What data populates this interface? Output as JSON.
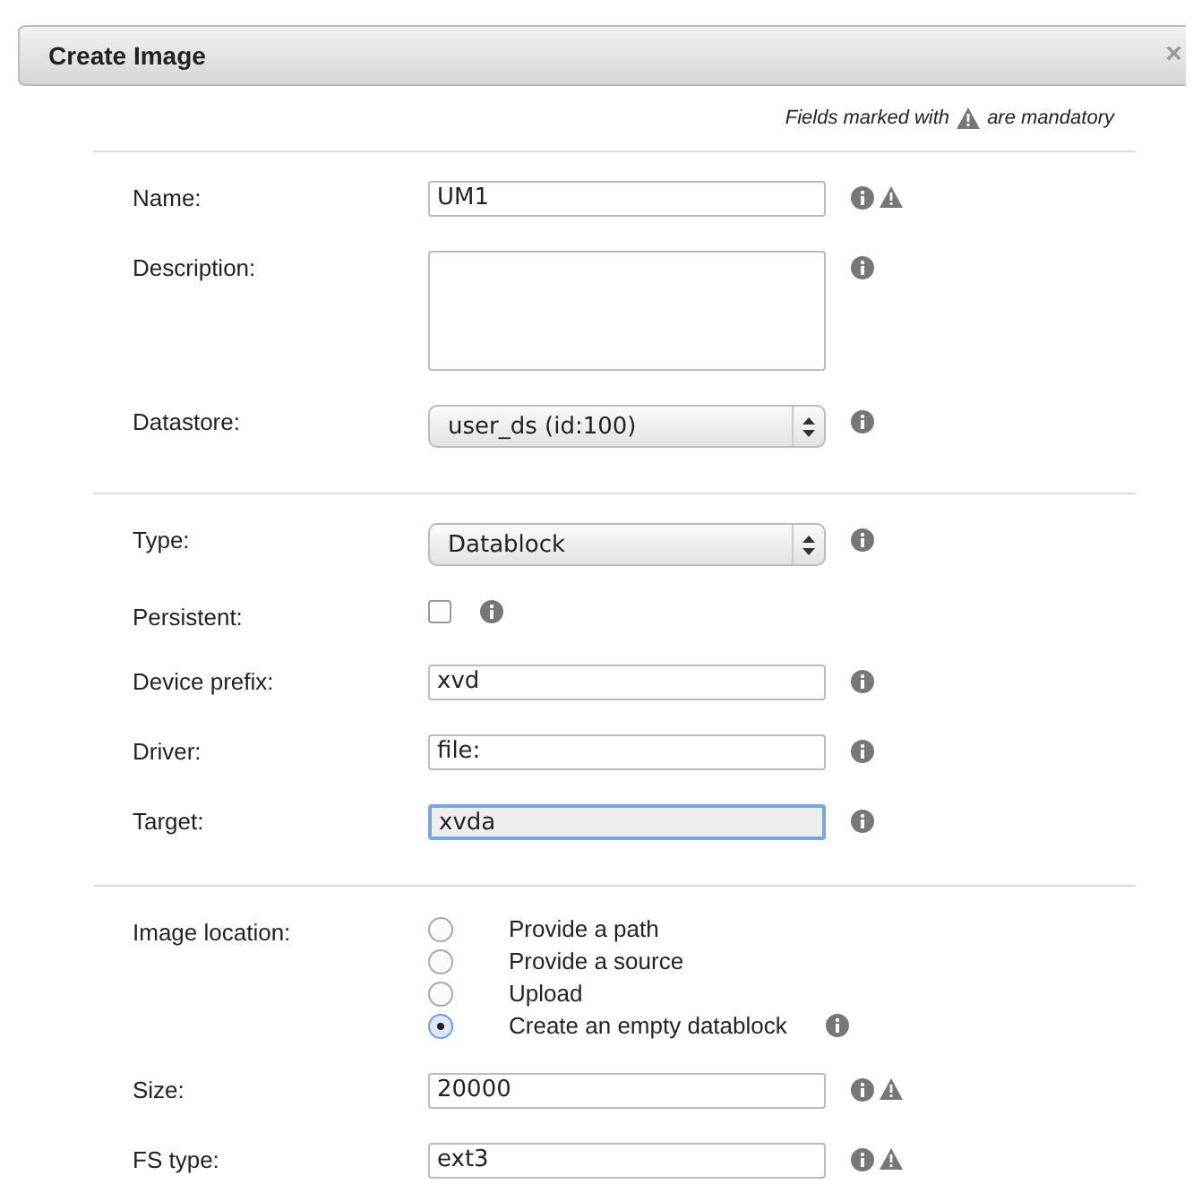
{
  "dialog": {
    "title": "Create Image",
    "close": "×"
  },
  "note": {
    "before": "Fields marked with",
    "after": "are mandatory"
  },
  "sections": [
    {
      "fields": [
        {
          "kind": "text",
          "label": "Name:",
          "value": "UM1",
          "mandatory": true,
          "focused": false
        },
        {
          "kind": "textarea",
          "label": "Description:",
          "mandatory": false
        },
        {
          "kind": "select",
          "label": "Datastore:",
          "value": "user_ds (id:100)",
          "mandatory": false
        }
      ]
    },
    {
      "fields": [
        {
          "kind": "select",
          "label": "Type:",
          "value": "Datablock",
          "mandatory": false
        },
        {
          "kind": "checkbox",
          "label": "Persistent:",
          "checked": false,
          "mandatory": false
        },
        {
          "kind": "text",
          "label": "Device prefix:",
          "value": "xvd",
          "mandatory": false,
          "focused": false
        },
        {
          "kind": "text",
          "label": "Driver:",
          "value": "file:",
          "mandatory": false,
          "focused": false
        },
        {
          "kind": "text",
          "label": "Target:",
          "value": "xvda",
          "mandatory": false,
          "focused": true
        }
      ]
    },
    {
      "fields": [
        {
          "kind": "radio",
          "label": "Image location:",
          "options": [
            {
              "label": "Provide a path",
              "selected": false,
              "info": false
            },
            {
              "label": "Provide a source",
              "selected": false,
              "info": false
            },
            {
              "label": "Upload",
              "selected": false,
              "info": false
            },
            {
              "label": "Create an empty datablock",
              "selected": true,
              "info": true
            }
          ]
        },
        {
          "kind": "text",
          "label": "Size:",
          "value": "20000",
          "mandatory": true,
          "focused": false
        },
        {
          "kind": "text",
          "label": "FS type:",
          "value": "ext3",
          "mandatory": true,
          "focused": false
        }
      ]
    }
  ]
}
